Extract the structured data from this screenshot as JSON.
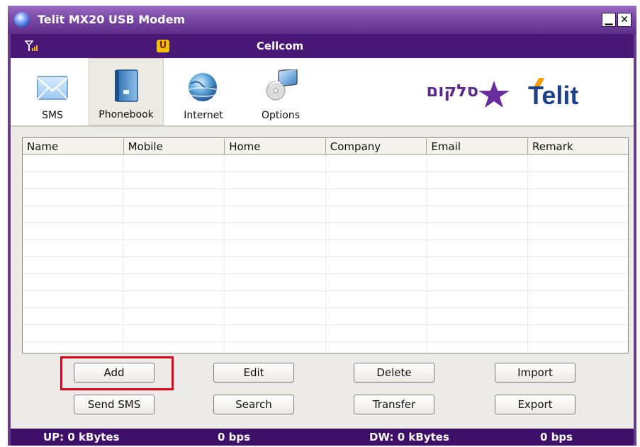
{
  "window": {
    "title": "Telit MX20 USB Modem",
    "minimize_symbol": "▁",
    "close_symbol": "✕"
  },
  "signal_bar": {
    "carrier": "Cellcom",
    "u_badge": "U",
    "signal_icon": "signal-strength-icon"
  },
  "toolbar": {
    "items": [
      {
        "label": "SMS",
        "icon": "envelope-icon"
      },
      {
        "label": "Phonebook",
        "icon": "phonebook-icon",
        "selected": true
      },
      {
        "label": "Internet",
        "icon": "globe-icon"
      },
      {
        "label": "Options",
        "icon": "computer-cd-icon"
      }
    ]
  },
  "logos": {
    "cellcom": "סלקום",
    "telit": "Telit"
  },
  "table": {
    "columns": [
      "Name",
      "Mobile",
      "Home",
      "Company",
      "Email",
      "Remark"
    ],
    "rows": []
  },
  "buttons": {
    "add": "Add",
    "edit": "Edit",
    "delete": "Delete",
    "import": "Import",
    "send_sms": "Send SMS",
    "search": "Search",
    "transfer": "Transfer",
    "export": "Export"
  },
  "status": {
    "up": "UP: 0 kBytes",
    "up_rate": "0 bps",
    "dw": "DW: 0 kBytes",
    "dw_rate": "0 bps"
  },
  "colors": {
    "title_bar": "#7a4aa6",
    "status_bar": "#3d0f68",
    "highlight": "#e3001b"
  }
}
